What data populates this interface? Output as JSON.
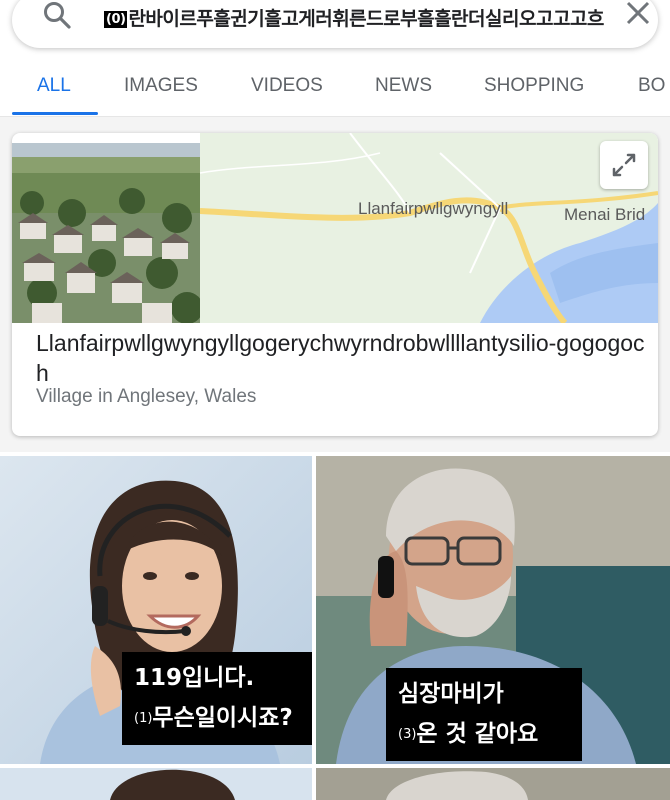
{
  "search": {
    "query_marker": "(0)",
    "query": "란바이르푸흘귄기흘고게러휘른드로부흘흘란더실리오고고고흐",
    "search_icon": "search-icon",
    "close_icon": "close-icon"
  },
  "tabs": [
    {
      "label": "ALL",
      "active": true
    },
    {
      "label": "IMAGES"
    },
    {
      "label": "VIDEOS"
    },
    {
      "label": "NEWS"
    },
    {
      "label": "SHOPPING"
    },
    {
      "label": "BO"
    }
  ],
  "knowledge_card": {
    "map_labels": [
      "Llanfairpwllgwyngyll",
      "Menai Brid"
    ],
    "expand_icon": "expand-icon",
    "title": "Llanfairpwllgwyngyllgogerychwyrndrobwllllantysilio-gogogoch",
    "subtitle": "Village in Anglesey, Wales"
  },
  "meme": {
    "panel1": {
      "line1": "119입니다.",
      "marker": "(1)",
      "line2": "무슨일이시죠?"
    },
    "panel2": {
      "line1": "심장마비가",
      "marker": "(3)",
      "line2": "온 것 같아요"
    }
  },
  "colors": {
    "accent": "#1a73e8",
    "tab_inactive": "#5f6368",
    "title": "#202124",
    "subtitle": "#70757a",
    "map_land": "#e8f1e2",
    "map_water": "#aecbf5",
    "map_road": "#f6d776"
  }
}
